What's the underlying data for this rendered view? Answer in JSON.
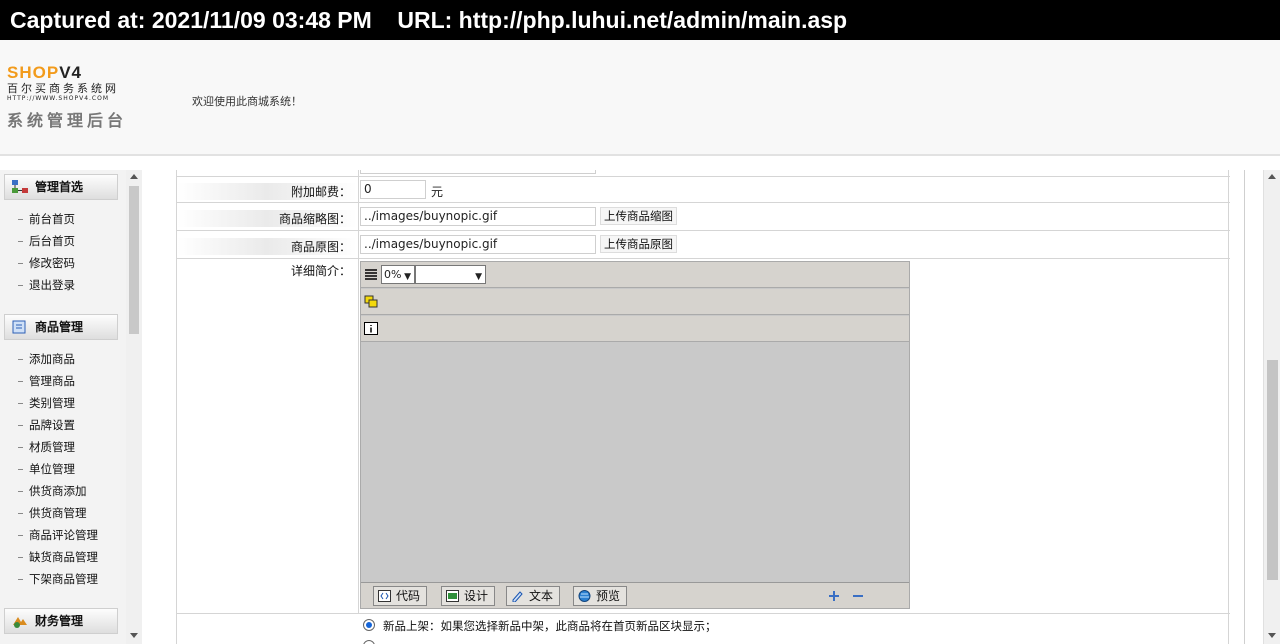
{
  "capture": {
    "text": "Captured at: 2021/11/09 03:48 PM    URL: http://php.luhui.net/admin/main.asp"
  },
  "header": {
    "logo_shop": "SHOP",
    "logo_v4": "V4",
    "logo_cn": "百尔买商务系统网",
    "logo_url": "HTTP://WWW.SHOPV4.COM",
    "logo_sys": "系统管理后台",
    "welcome": "欢迎使用此商城系统！"
  },
  "sidebar": {
    "sections": [
      {
        "title": "管理首选",
        "items": [
          "前台首页",
          "后台首页",
          "修改密码",
          "退出登录"
        ]
      },
      {
        "title": "商品管理",
        "items": [
          "添加商品",
          "管理商品",
          "类别管理",
          "品牌设置",
          "材质管理",
          "单位管理",
          "供货商添加",
          "供货商管理",
          "商品评论管理",
          "缺货商品管理",
          "下架商品管理"
        ]
      },
      {
        "title": "财务管理",
        "items": []
      }
    ]
  },
  "form": {
    "postage_label": "附加邮费：",
    "postage_value": "0",
    "postage_unit": "元",
    "thumb_label": "商品缩略图：",
    "thumb_value": "../images/buynopic.gif",
    "thumb_button": "上传商品缩图",
    "orig_label": "商品原图：",
    "orig_value": "../images/buynopic.gif",
    "orig_button": "上传商品原图",
    "detail_label": "详细简介：",
    "zoom_value": "0%",
    "mode_code": "代码",
    "mode_design": "设计",
    "mode_text": "文本",
    "mode_preview": "预览",
    "new_item_text": "新品上架：如果您选择新品中架，此商品将在首页新品区块显示；"
  }
}
